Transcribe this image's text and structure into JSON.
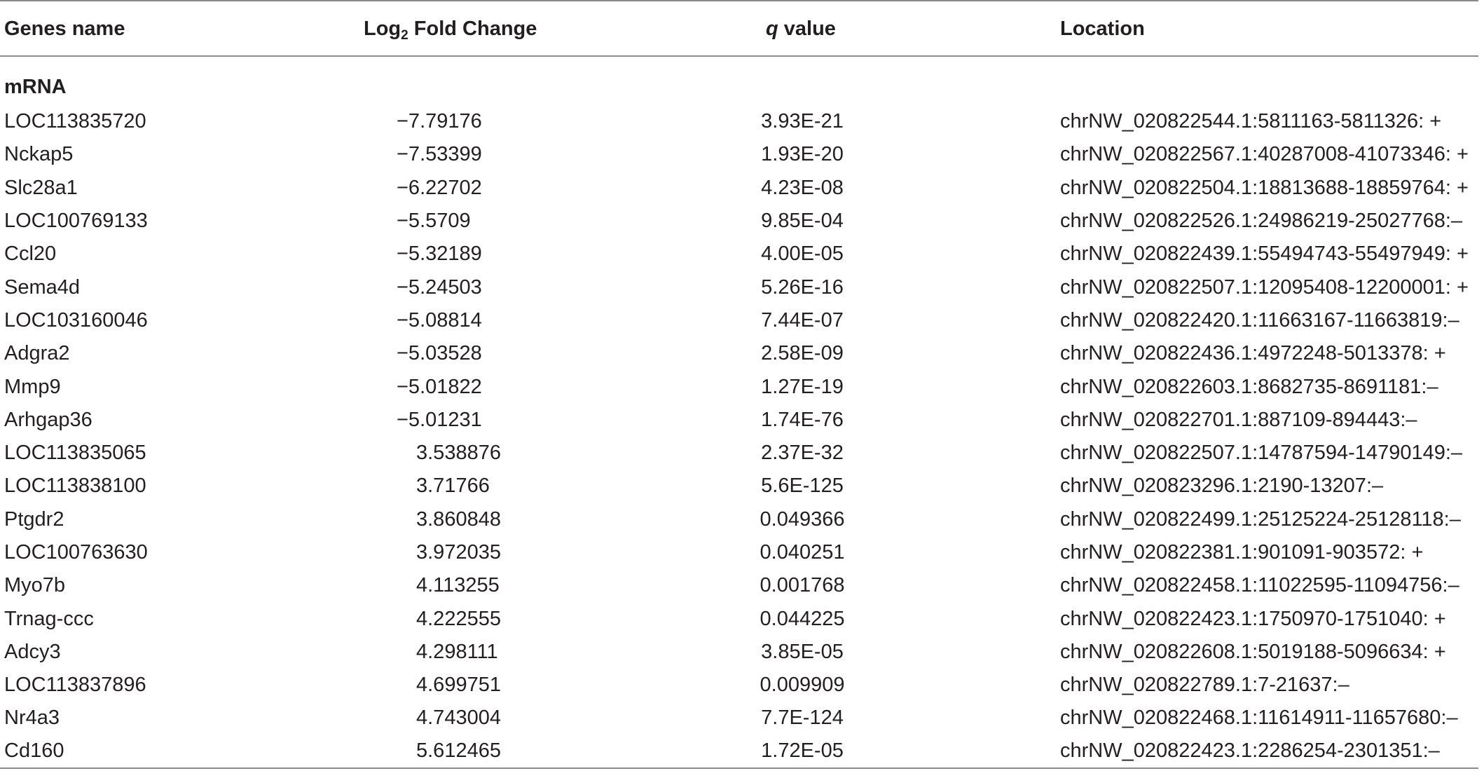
{
  "table": {
    "headers": {
      "gene": "Genes name",
      "fc_prefix": "Log",
      "fc_sub": "2",
      "fc_suffix": " Fold Change",
      "q_italic": "q",
      "q_suffix": " value",
      "location": "Location"
    },
    "section_label": "mRNA",
    "rows": [
      {
        "gene": "LOC113835720",
        "fc": "−7.79176",
        "q": "3.93E-21",
        "location": "chrNW_020822544.1:5811163-5811326: +"
      },
      {
        "gene": "Nckap5",
        "fc": "−7.53399",
        "q": "1.93E-20",
        "location": "chrNW_020822567.1:40287008-41073346: +"
      },
      {
        "gene": "Slc28a1",
        "fc": "−6.22702",
        "q": "4.23E-08",
        "location": "chrNW_020822504.1:18813688-18859764: +"
      },
      {
        "gene": "LOC100769133",
        "fc": "−5.5709",
        "q": "9.85E-04",
        "location": "chrNW_020822526.1:24986219-25027768:–"
      },
      {
        "gene": "Ccl20",
        "fc": "−5.32189",
        "q": "4.00E-05",
        "location": "chrNW_020822439.1:55494743-55497949: +"
      },
      {
        "gene": "Sema4d",
        "fc": "−5.24503",
        "q": "5.26E-16",
        "location": "chrNW_020822507.1:12095408-12200001: +"
      },
      {
        "gene": "LOC103160046",
        "fc": "−5.08814",
        "q": "7.44E-07",
        "location": "chrNW_020822420.1:11663167-11663819:–"
      },
      {
        "gene": "Adgra2",
        "fc": "−5.03528",
        "q": "2.58E-09",
        "location": "chrNW_020822436.1:4972248-5013378: +"
      },
      {
        "gene": "Mmp9",
        "fc": "−5.01822",
        "q": "1.27E-19",
        "location": "chrNW_020822603.1:8682735-8691181:–"
      },
      {
        "gene": "Arhgap36",
        "fc": "−5.01231",
        "q": "1.74E-76",
        "location": "chrNW_020822701.1:887109-894443:–"
      },
      {
        "gene": "LOC113835065",
        "fc": "3.538876",
        "q": "2.37E-32",
        "location": "chrNW_020822507.1:14787594-14790149:–"
      },
      {
        "gene": "LOC113838100",
        "fc": "3.71766",
        "q": "5.6E-125",
        "location": "chrNW_020823296.1:2190-13207:–"
      },
      {
        "gene": "Ptgdr2",
        "fc": "3.860848",
        "q": "0.049366",
        "location": "chrNW_020822499.1:25125224-25128118:–"
      },
      {
        "gene": "LOC100763630",
        "fc": "3.972035",
        "q": "0.040251",
        "location": "chrNW_020822381.1:901091-903572: +"
      },
      {
        "gene": "Myo7b",
        "fc": "4.113255",
        "q": "0.001768",
        "location": "chrNW_020822458.1:11022595-11094756:–"
      },
      {
        "gene": "Trnag-ccc",
        "fc": "4.222555",
        "q": "0.044225",
        "location": "chrNW_020822423.1:1750970-1751040: +"
      },
      {
        "gene": "Adcy3",
        "fc": "4.298111",
        "q": "3.85E-05",
        "location": "chrNW_020822608.1:5019188-5096634: +"
      },
      {
        "gene": "LOC113837896",
        "fc": "4.699751",
        "q": "0.009909",
        "location": "chrNW_020822789.1:7-21637:–"
      },
      {
        "gene": "Nr4a3",
        "fc": "4.743004",
        "q": "7.7E-124",
        "location": "chrNW_020822468.1:11614911-11657680:–"
      },
      {
        "gene": "Cd160",
        "fc": "5.612465",
        "q": "1.72E-05",
        "location": "chrNW_020822423.1:2286254-2301351:–"
      }
    ]
  }
}
